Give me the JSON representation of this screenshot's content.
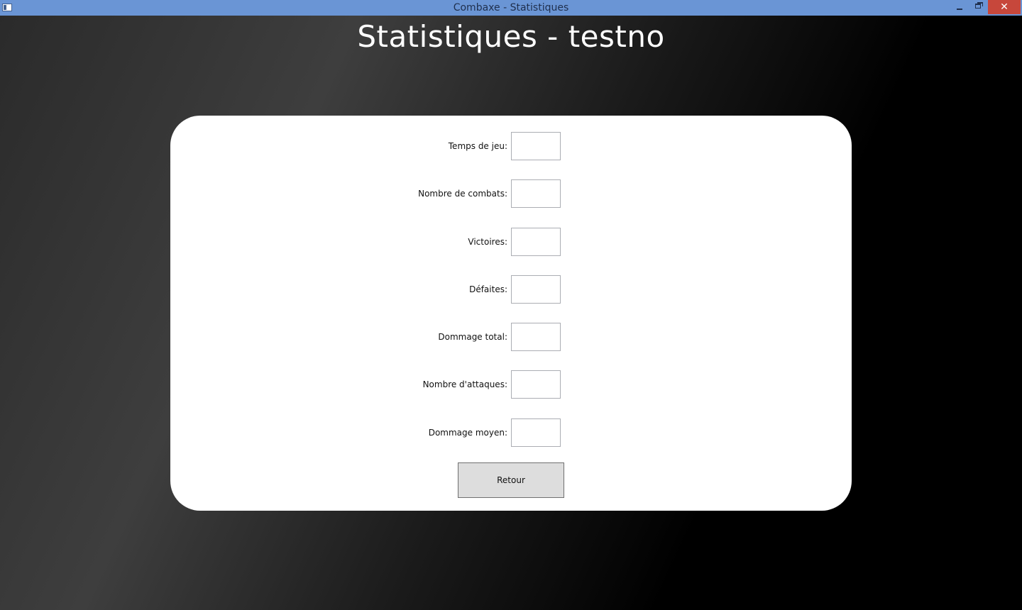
{
  "window": {
    "title": "Combaxe - Statistiques",
    "controls": {
      "minimize_icon": "minimize-icon",
      "maximize_icon": "restore-icon",
      "close_icon": "close-icon",
      "close_glyph": "✕"
    },
    "colors": {
      "titlebar": "#6a95d5",
      "close_button": "#c7473b",
      "panel": "#ffffff",
      "button": "#dddddd"
    }
  },
  "page": {
    "heading": "Statistiques - testno"
  },
  "stats": [
    {
      "label": "Temps de jeu:",
      "value": ""
    },
    {
      "label": "Nombre de combats:",
      "value": ""
    },
    {
      "label": "Victoires:",
      "value": ""
    },
    {
      "label": "Défaites:",
      "value": ""
    },
    {
      "label": "Dommage total:",
      "value": ""
    },
    {
      "label": "Nombre d'attaques:",
      "value": ""
    },
    {
      "label": "Dommage moyen:",
      "value": ""
    }
  ],
  "actions": {
    "retour_label": "Retour"
  }
}
